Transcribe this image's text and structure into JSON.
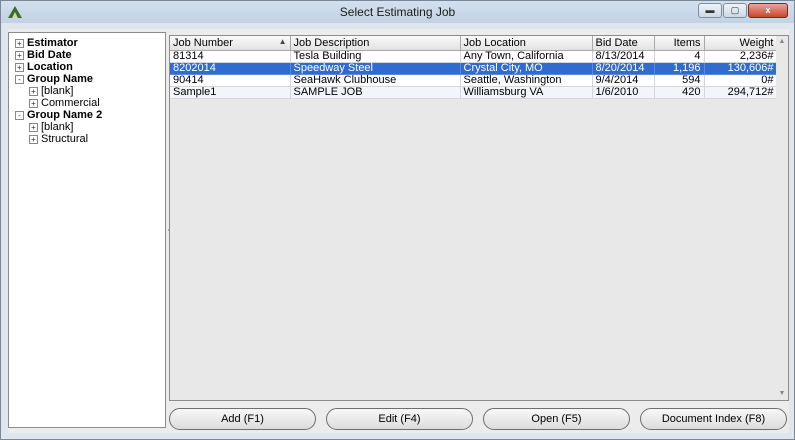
{
  "window": {
    "title": "Select Estimating Job",
    "minimize": "▬",
    "maximize": "▢",
    "close": "x"
  },
  "tree": {
    "nodes": [
      {
        "label": "Estimator",
        "bold": true,
        "child": false,
        "exp": "+"
      },
      {
        "label": "Bid Date",
        "bold": true,
        "child": false,
        "exp": "+"
      },
      {
        "label": "Location",
        "bold": true,
        "child": false,
        "exp": "+"
      },
      {
        "label": "Group Name",
        "bold": true,
        "child": false,
        "exp": "-"
      },
      {
        "label": "[blank]",
        "bold": false,
        "child": true,
        "exp": "+"
      },
      {
        "label": "Commercial",
        "bold": false,
        "child": true,
        "exp": "+"
      },
      {
        "label": "Group Name 2",
        "bold": true,
        "child": false,
        "exp": "-"
      },
      {
        "label": "[blank]",
        "bold": false,
        "child": true,
        "exp": "+"
      },
      {
        "label": "Structural",
        "bold": false,
        "child": true,
        "exp": "+"
      }
    ]
  },
  "grid": {
    "columns": [
      "Job Number",
      "Job Description",
      "Job Location",
      "Bid Date",
      "Items",
      "Weight"
    ],
    "sort_indicator": "▲",
    "rows": [
      [
        "81314",
        "Tesla Building",
        "Any Town, California",
        "8/13/2014",
        "4",
        "2,236#"
      ],
      [
        "8202014",
        "Speedway Steel",
        "Crystal City, MO",
        "8/20/2014",
        "1,196",
        "130,606#"
      ],
      [
        "90414",
        "SeaHawk Clubhouse",
        "Seattle, Washington",
        "9/4/2014",
        "594",
        "0#"
      ],
      [
        "Sample1",
        "SAMPLE JOB",
        "Williamsburg VA",
        "1/6/2010",
        "420",
        "294,712#"
      ]
    ],
    "selected_row": 1,
    "scroll_up": "▲",
    "scroll_down": "▼"
  },
  "buttons": {
    "add": "Add (F1)",
    "edit": "Edit (F4)",
    "open": "Open (F5)",
    "document_index": "Document Index (F8)"
  }
}
